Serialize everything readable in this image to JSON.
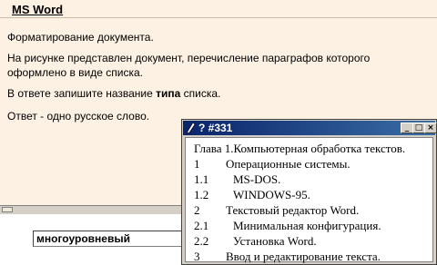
{
  "app": {
    "title": "MS Word"
  },
  "question": {
    "lines": [
      "Форматирование документа.",
      "На рисунке представлен документ, перечисление параграфов которого",
      "оформлено в виде списка.",
      "В ответе запишите название ",
      "типа",
      " списка.",
      "Ответ - одно русское слово."
    ]
  },
  "answer": {
    "value": "многоуровневый"
  },
  "popup": {
    "title": "? #331",
    "buttons": {
      "minimize": "_",
      "maximize": "□",
      "close": "×"
    },
    "document": {
      "heading": "Глава 1.Компьютерная обработка текстов.",
      "items": [
        {
          "num": "1",
          "text": "Операционные системы."
        },
        {
          "num": "1.1",
          "text": "MS-DOS."
        },
        {
          "num": "1.2",
          "text": "WINDOWS-95."
        },
        {
          "num": "2",
          "text": "Текстовый редактор Word."
        },
        {
          "num": "2.1",
          "text": "Минимальная конфигурация."
        },
        {
          "num": "2.2",
          "text": "Установка Word."
        },
        {
          "num": "3",
          "text": "Ввод и редактирование текста."
        }
      ]
    }
  }
}
